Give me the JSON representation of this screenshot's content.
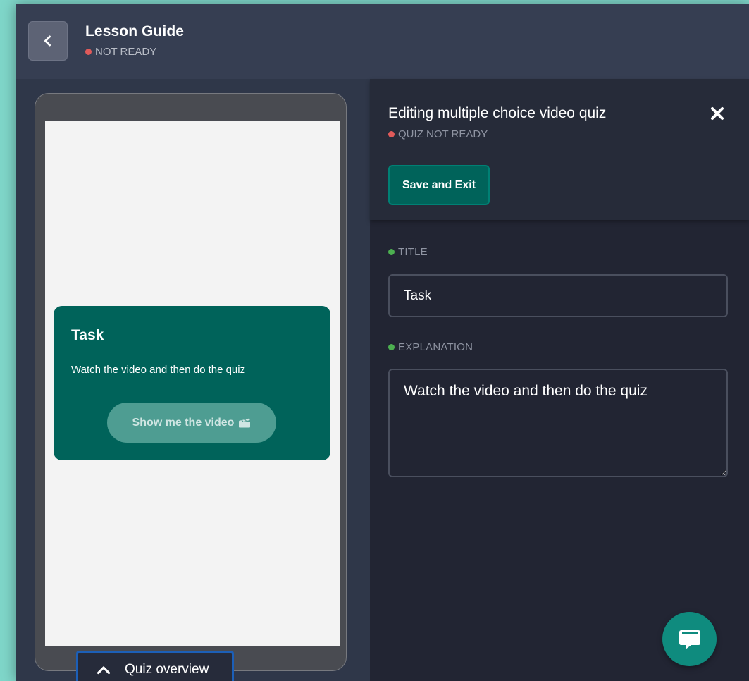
{
  "header": {
    "title": "Lesson Guide",
    "status": "NOT READY",
    "status_color": "#e05a5a",
    "back_icon": "chevron-left-icon"
  },
  "preview": {
    "card_title": "Task",
    "card_text": "Watch the video and then do the quiz",
    "video_button_label": "Show me the video",
    "video_button_icon": "clapperboard-icon",
    "card_color": "#00635a"
  },
  "quiz_overview": {
    "label": "Quiz overview",
    "icon": "chevron-up-icon"
  },
  "editor": {
    "title": "Editing multiple choice video quiz",
    "status": "QUIZ NOT READY",
    "save_label": "Save and Exit",
    "close_icon": "close-icon",
    "fields": {
      "title_label": "TITLE",
      "title_value": "Task",
      "explanation_label": "EXPLANATION",
      "explanation_value": "Watch the video and then do the quiz"
    },
    "valid_color": "#4caf50"
  },
  "chat": {
    "icon": "chat-icon",
    "color": "#0f8b7e"
  }
}
